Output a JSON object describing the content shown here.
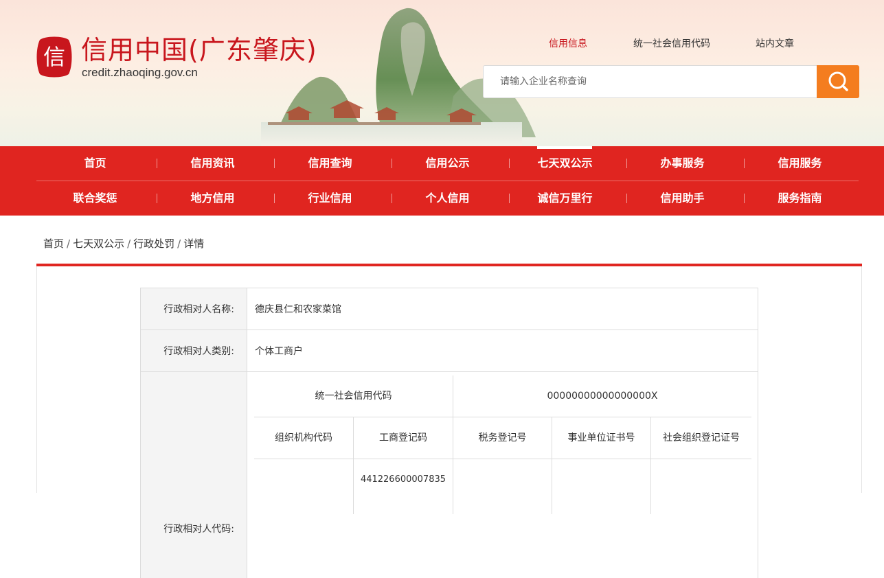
{
  "header": {
    "logo_seal_char": "信",
    "site_title": "信用中国(广东肇庆)",
    "site_url": "credit.zhaoqing.gov.cn",
    "top_links": [
      "信用信息",
      "统一社会信用代码",
      "站内文章"
    ],
    "search_placeholder": "请输入企业名称查询",
    "colors": {
      "accent_red": "#e02520",
      "search_orange": "#f47d1f",
      "title_red": "#c8161d"
    }
  },
  "nav": {
    "row1": [
      "首页",
      "信用资讯",
      "信用查询",
      "信用公示",
      "七天双公示",
      "办事服务",
      "信用服务"
    ],
    "row2": [
      "联合奖惩",
      "地方信用",
      "行业信用",
      "个人信用",
      "诚信万里行",
      "信用助手",
      "服务指南"
    ],
    "active": "七天双公示",
    "separator": "|"
  },
  "breadcrumb": {
    "items": [
      "首页",
      "七天双公示",
      "行政处罚"
    ],
    "current": "详情",
    "separator": "/"
  },
  "detail": {
    "name_label": "行政相对人名称:",
    "name_value": "德庆县仁和农家菜馆",
    "type_label": "行政相对人类别:",
    "type_value": "个体工商户",
    "code_label": "行政相对人代码:",
    "unified_code_label": "统一社会信用代码",
    "unified_code_value": "00000000000000000X",
    "code_headers": [
      "组织机构代码",
      "工商登记码",
      "税务登记号",
      "事业单位证书号",
      "社会组织登记证号"
    ],
    "code_values": [
      "",
      "441226600007835",
      "",
      "",
      ""
    ]
  }
}
